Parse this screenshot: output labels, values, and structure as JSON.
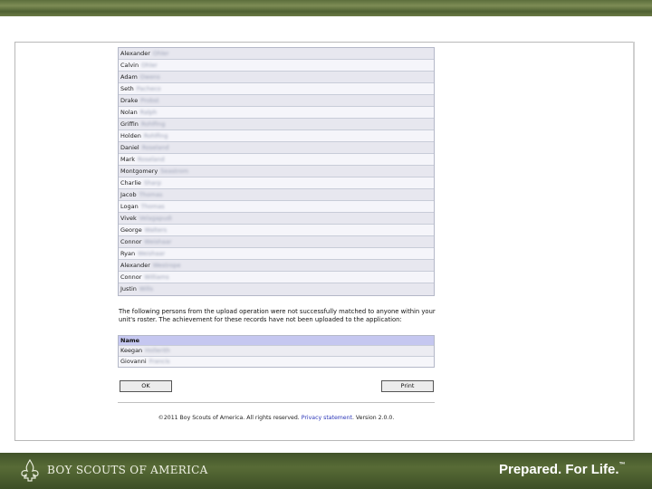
{
  "branding": {
    "org_name": "BOY SCOUTS OF AMERICA",
    "tagline": "Prepared. For Life.",
    "tagline_mark": "™",
    "colors": {
      "band_green": "#4f6132",
      "header_blue": "#c5c7f0",
      "link_blue": "#2a35b8"
    },
    "logo_icon": "fleur-de-lis-icon"
  },
  "roster": {
    "rows": [
      {
        "first": "Alexander",
        "last": "Ohler"
      },
      {
        "first": "Calvin",
        "last": "Ohler"
      },
      {
        "first": "Adam",
        "last": "Owens"
      },
      {
        "first": "Seth",
        "last": "Pacheco"
      },
      {
        "first": "Drake",
        "last": "Probst"
      },
      {
        "first": "Nolan",
        "last": "Ralph"
      },
      {
        "first": "Griffin",
        "last": "Rohlfing"
      },
      {
        "first": "Holden",
        "last": "Rohlfing"
      },
      {
        "first": "Daniel",
        "last": "Roseland"
      },
      {
        "first": "Mark",
        "last": "Roseland"
      },
      {
        "first": "Montgomery",
        "last": "Seastrom"
      },
      {
        "first": "Charlie",
        "last": "Sharp"
      },
      {
        "first": "Jacob",
        "last": "Thomas"
      },
      {
        "first": "Logan",
        "last": "Thomas"
      },
      {
        "first": "Vivek",
        "last": "Velagapudi"
      },
      {
        "first": "George",
        "last": "Walters"
      },
      {
        "first": "Connor",
        "last": "Weishaar"
      },
      {
        "first": "Ryan",
        "last": "Weishaar"
      },
      {
        "first": "Alexander",
        "last": "Westrope"
      },
      {
        "first": "Connor",
        "last": "Williams"
      },
      {
        "first": "Justin",
        "last": "Wills"
      }
    ]
  },
  "notice": {
    "text": "The following persons from the upload operation were not successfully matched to anyone within your unit's roster. The achievement for these records have not been uploaded to the application:"
  },
  "unmatched": {
    "header": "Name",
    "rows": [
      {
        "first": "Keegan",
        "last": "Hollerith"
      },
      {
        "first": "Giovanni",
        "last": "Francis"
      }
    ]
  },
  "buttons": {
    "ok": "OK",
    "print": "Print"
  },
  "footer": {
    "copyright": "©2011 Boy Scouts of America. All rights reserved.",
    "privacy_link": "Privacy statement",
    "version": ". Version 2.0.0."
  }
}
